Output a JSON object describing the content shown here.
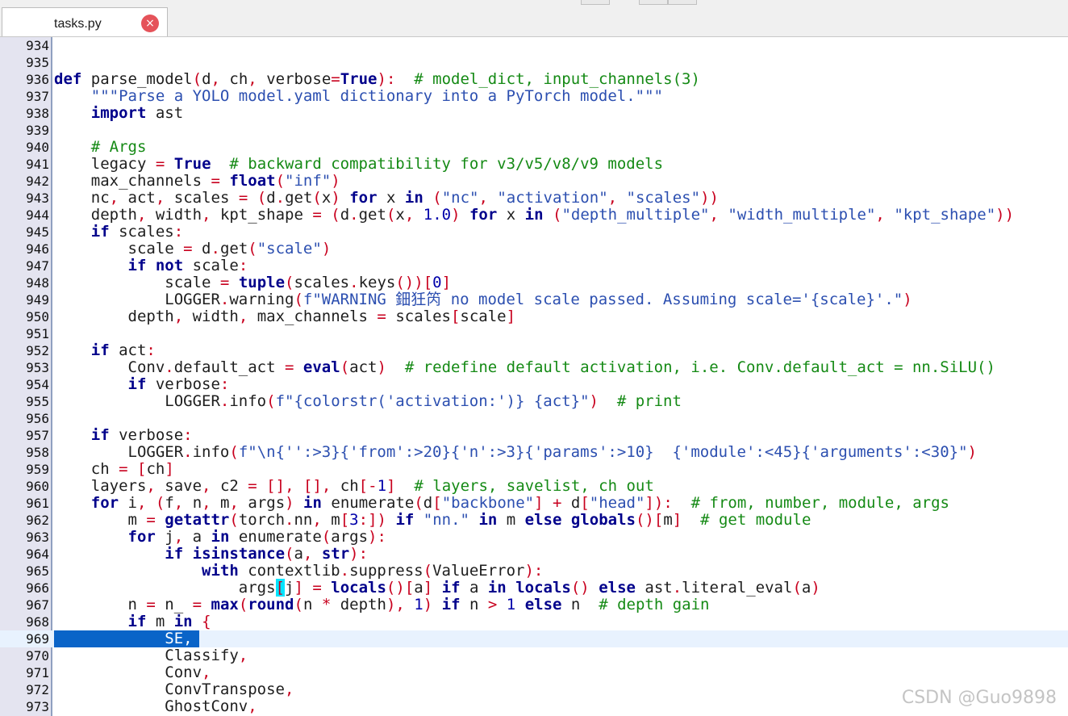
{
  "tab": {
    "filename": "tasks.py",
    "close_icon": "×"
  },
  "watermark": "CSDN @Guo9898",
  "selected_line": "969",
  "lines": [
    {
      "n": "934",
      "t": ""
    },
    {
      "n": "935",
      "t": ""
    },
    {
      "n": "936",
      "t": "def parse_model(d, ch, verbose=True):  # model_dict, input_channels(3)"
    },
    {
      "n": "937",
      "t": "    \"\"\"Parse a YOLO model.yaml dictionary into a PyTorch model.\"\"\""
    },
    {
      "n": "938",
      "t": "    import ast"
    },
    {
      "n": "939",
      "t": ""
    },
    {
      "n": "940",
      "t": "    # Args"
    },
    {
      "n": "941",
      "t": "    legacy = True  # backward compatibility for v3/v5/v8/v9 models"
    },
    {
      "n": "942",
      "t": "    max_channels = float(\"inf\")"
    },
    {
      "n": "943",
      "t": "    nc, act, scales = (d.get(x) for x in (\"nc\", \"activation\", \"scales\"))"
    },
    {
      "n": "944",
      "t": "    depth, width, kpt_shape = (d.get(x, 1.0) for x in (\"depth_multiple\", \"width_multiple\", \"kpt_shape\"))"
    },
    {
      "n": "945",
      "t": "    if scales:"
    },
    {
      "n": "946",
      "t": "        scale = d.get(\"scale\")"
    },
    {
      "n": "947",
      "t": "        if not scale:"
    },
    {
      "n": "948",
      "t": "            scale = tuple(scales.keys())[0]"
    },
    {
      "n": "949",
      "t": "            LOGGER.warning(f\"WARNING 鈿狅笍 no model scale passed. Assuming scale='{scale}'.\")"
    },
    {
      "n": "950",
      "t": "        depth, width, max_channels = scales[scale]"
    },
    {
      "n": "951",
      "t": ""
    },
    {
      "n": "952",
      "t": "    if act:"
    },
    {
      "n": "953",
      "t": "        Conv.default_act = eval(act)  # redefine default activation, i.e. Conv.default_act = nn.SiLU()"
    },
    {
      "n": "954",
      "t": "        if verbose:"
    },
    {
      "n": "955",
      "t": "            LOGGER.info(f\"{colorstr('activation:')} {act}\")  # print"
    },
    {
      "n": "956",
      "t": ""
    },
    {
      "n": "957",
      "t": "    if verbose:"
    },
    {
      "n": "958",
      "t": "        LOGGER.info(f\"\\n{'':>3}{'from':>20}{'n':>3}{'params':>10}  {'module':<45}{'arguments':<30}\")"
    },
    {
      "n": "959",
      "t": "    ch = [ch]"
    },
    {
      "n": "960",
      "t": "    layers, save, c2 = [], [], ch[-1]  # layers, savelist, ch out"
    },
    {
      "n": "961",
      "t": "    for i, (f, n, m, args) in enumerate(d[\"backbone\"] + d[\"head\"]):  # from, number, module, args"
    },
    {
      "n": "962",
      "t": "        m = getattr(torch.nn, m[3:]) if \"nn.\" in m else globals()[m]  # get module"
    },
    {
      "n": "963",
      "t": "        for j, a in enumerate(args):"
    },
    {
      "n": "964",
      "t": "            if isinstance(a, str):"
    },
    {
      "n": "965",
      "t": "                with contextlib.suppress(ValueError):"
    },
    {
      "n": "966",
      "t": "                    args[j] = locals()[a] if a in locals() else ast.literal_eval(a)"
    },
    {
      "n": "967",
      "t": "        n = n_ = max(round(n * depth), 1) if n > 1 else n  # depth gain"
    },
    {
      "n": "968",
      "t": "        if m in {"
    },
    {
      "n": "969",
      "t": "            SE,"
    },
    {
      "n": "970",
      "t": "            Classify,"
    },
    {
      "n": "971",
      "t": "            Conv,"
    },
    {
      "n": "972",
      "t": "            ConvTranspose,"
    },
    {
      "n": "973",
      "t": "            GhostConv,"
    }
  ]
}
